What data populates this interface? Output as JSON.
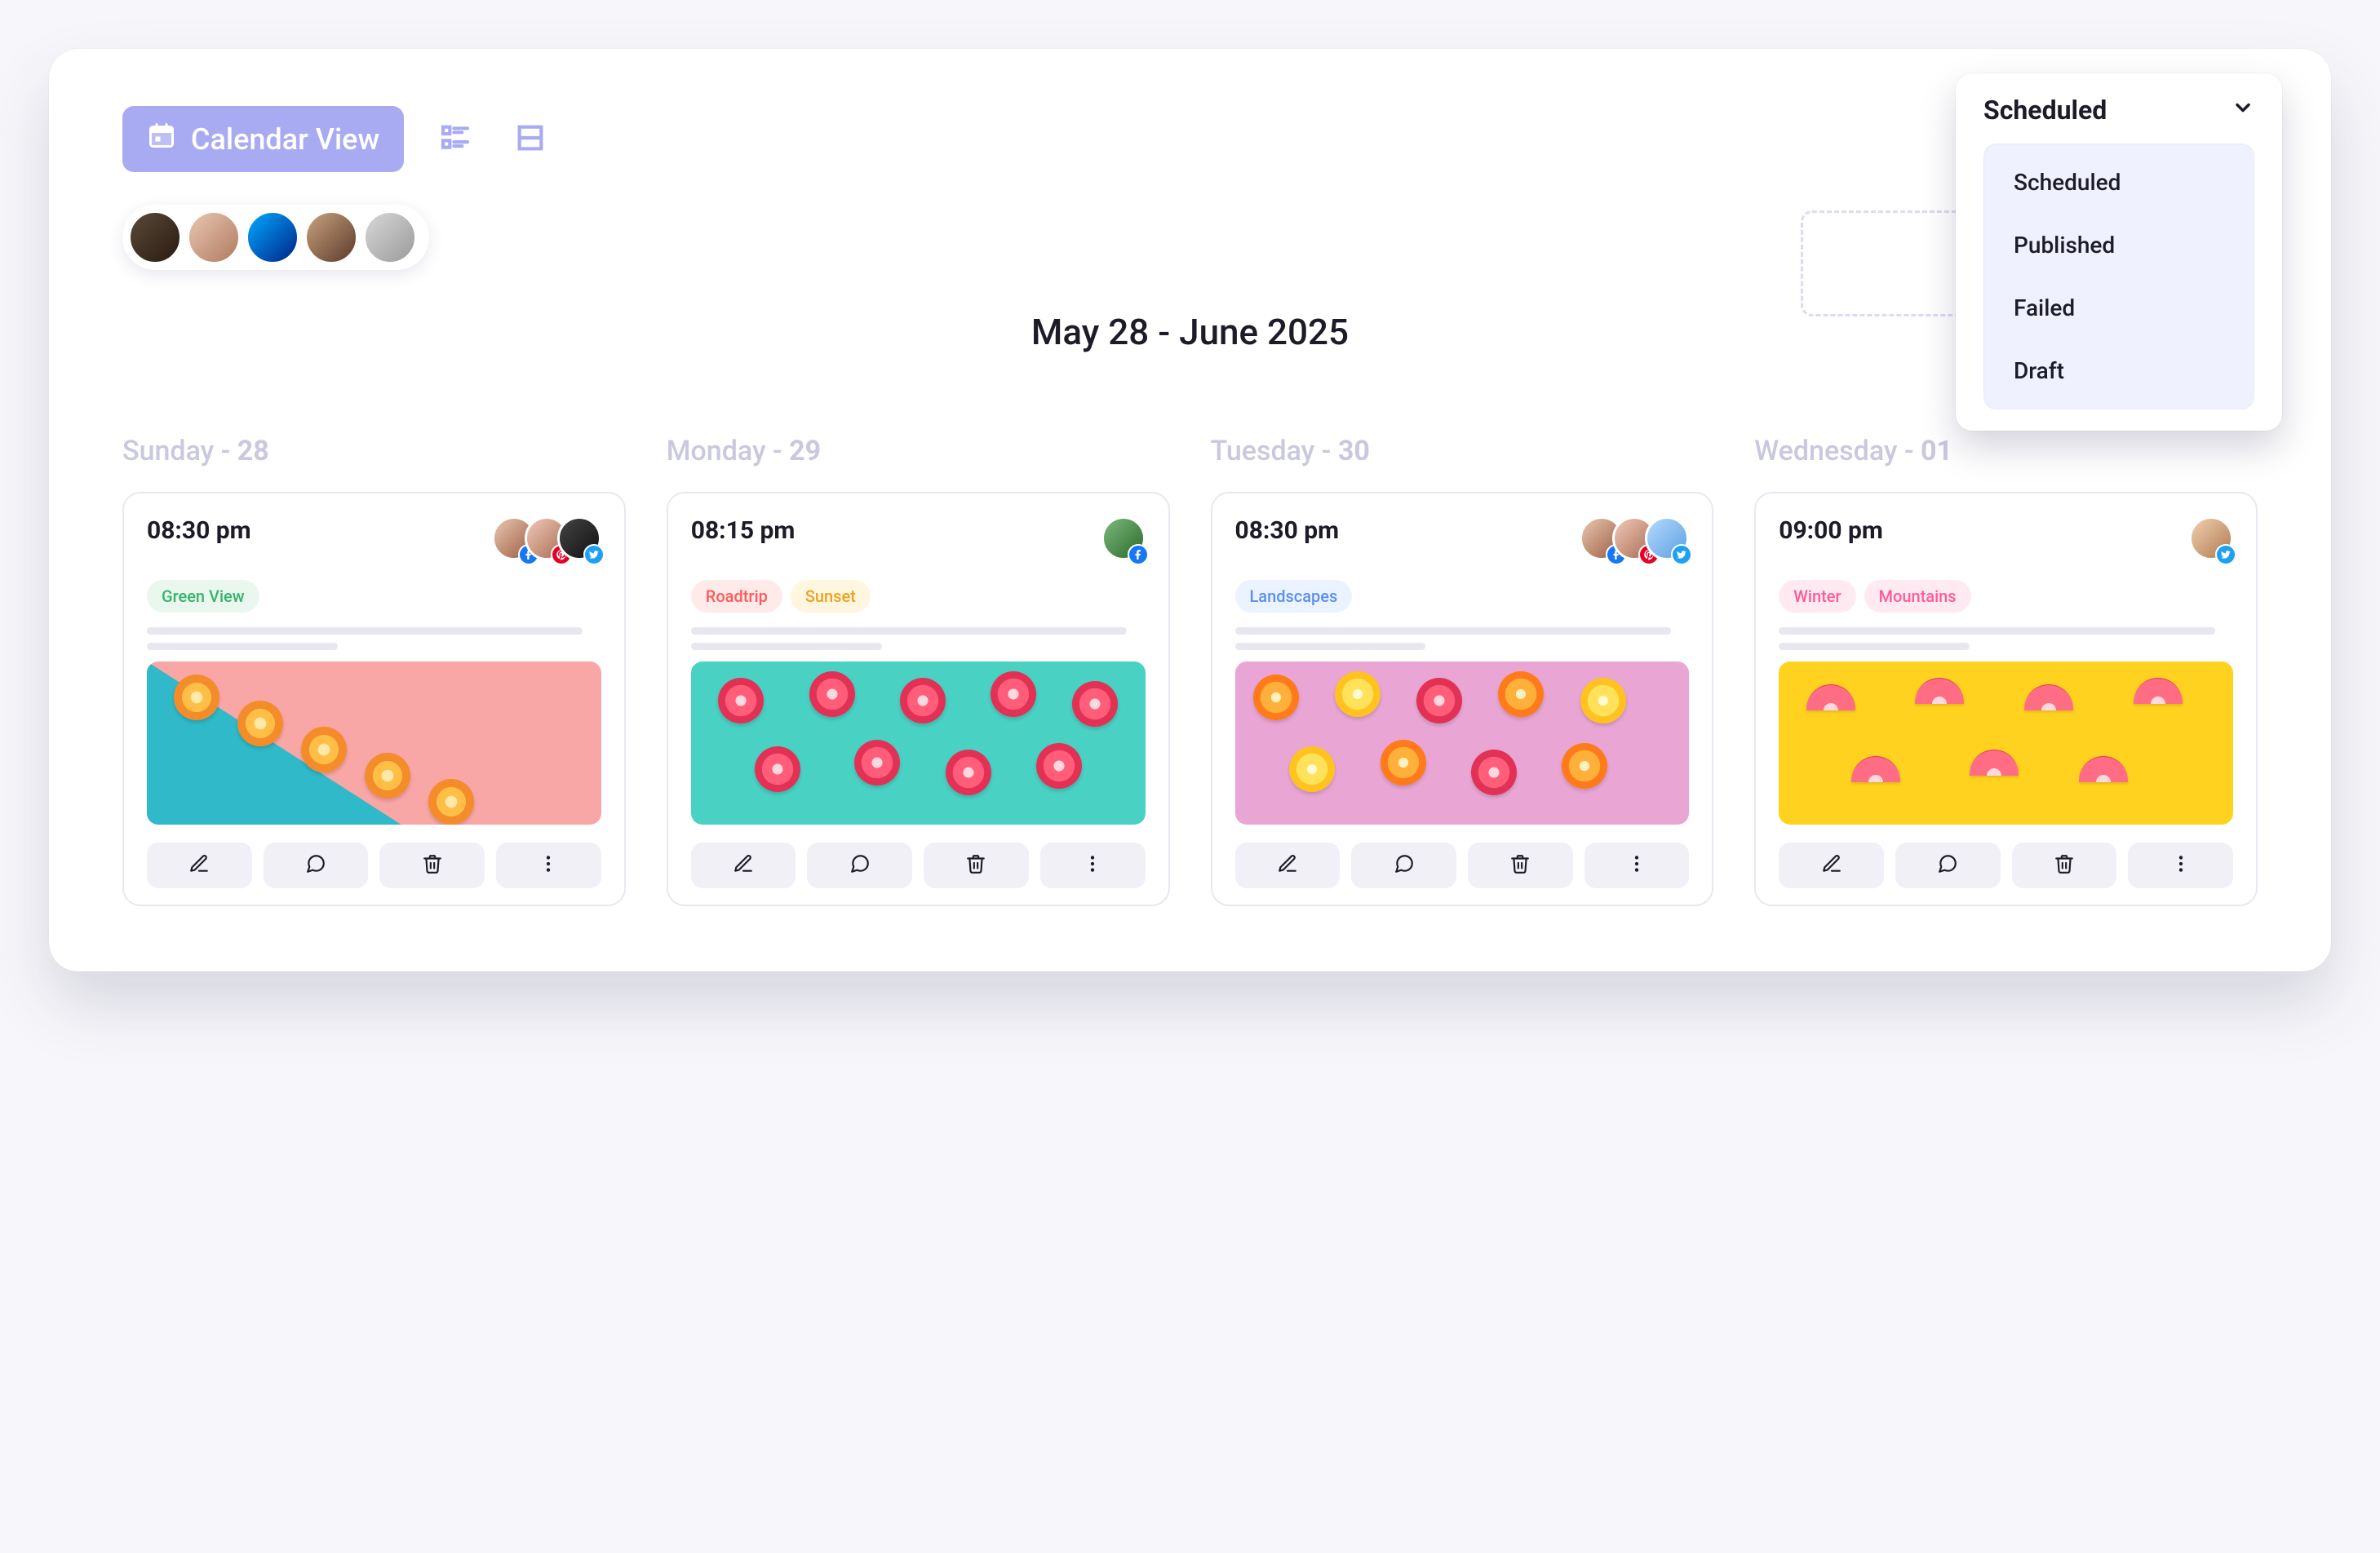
{
  "toolbar": {
    "calendar_label": "Calendar View"
  },
  "date_range": "May 28 - June 2025",
  "filter": {
    "selected": "Scheduled",
    "options": [
      "Scheduled",
      "Published",
      "Failed",
      "Draft"
    ]
  },
  "days": [
    {
      "weekday": "Sunday",
      "sep": " - ",
      "num": "28"
    },
    {
      "weekday": "Monday",
      "sep": " - ",
      "num": "29"
    },
    {
      "weekday": "Tuesday",
      "sep": " - ",
      "num": "30"
    },
    {
      "weekday": "Wednesday",
      "sep": " - ",
      "num": "01"
    }
  ],
  "cards": [
    {
      "time": "08:30 pm",
      "tags": [
        {
          "label": "Green View",
          "bg": "#e9f7ef",
          "fg": "#38b36b"
        }
      ],
      "avatars": [
        {
          "cls": "c1",
          "net": "fb"
        },
        {
          "cls": "c2",
          "net": "pi"
        },
        {
          "cls": "c3",
          "net": "tw"
        }
      ]
    },
    {
      "time": "08:15 pm",
      "tags": [
        {
          "label": "Roadtrip",
          "bg": "#ffeaea",
          "fg": "#ff5a5a"
        },
        {
          "label": "Sunset",
          "bg": "#fff6e0",
          "fg": "#f0a020"
        }
      ],
      "avatars": [
        {
          "cls": "c4",
          "net": "fb"
        }
      ]
    },
    {
      "time": "08:30 pm",
      "tags": [
        {
          "label": "Landscapes",
          "bg": "#eaf3ff",
          "fg": "#5a8ff0"
        }
      ],
      "avatars": [
        {
          "cls": "c1",
          "net": "fb"
        },
        {
          "cls": "c2",
          "net": "pi"
        },
        {
          "cls": "c5",
          "net": "tw"
        }
      ]
    },
    {
      "time": "09:00 pm",
      "tags": [
        {
          "label": "Winter",
          "bg": "#ffeaf2",
          "fg": "#ff5a9a"
        },
        {
          "label": "Mountains",
          "bg": "#ffeaf2",
          "fg": "#ff5a9a"
        }
      ],
      "avatars": [
        {
          "cls": "c6",
          "net": "tw"
        }
      ]
    }
  ]
}
